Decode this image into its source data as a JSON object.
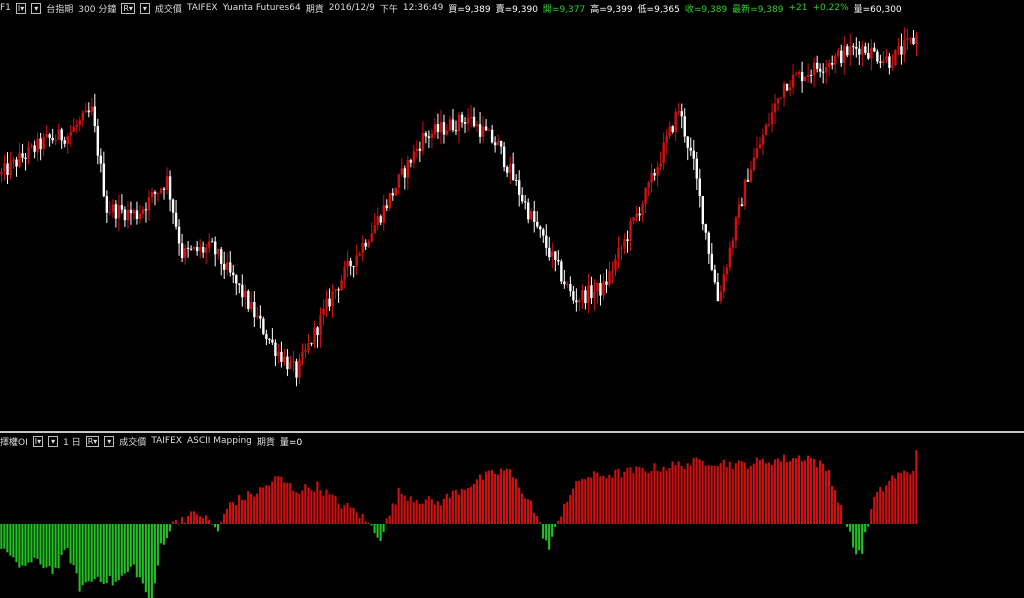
{
  "top_bar": {
    "symbol": "F1",
    "product": "台指期",
    "interval": "300 分鐘",
    "r_button": "R",
    "price_type": "成交價",
    "exchange": "TAIFEX",
    "source": "Yuanta Futures64",
    "market": "期貨",
    "date": "2016/12/9",
    "ampm": "下午",
    "time": "12:36:49",
    "bid": "買=9,389",
    "ask": "賣=9,390",
    "open": "開=9,377",
    "high": "高=9,399",
    "low": "低=9,365",
    "close": "收=9,389",
    "last": "最新=9,389",
    "change": "+21",
    "change_pct": "+0.22%",
    "volume": "量=60,300"
  },
  "sub_bar": {
    "indicator": "擇權OI",
    "interval": "1 日",
    "r_button": "R",
    "price_type": "成交價",
    "exchange": "TAIFEX",
    "source": "ASCII Mapping",
    "market": "期貨",
    "volume": "量=0"
  },
  "colors": {
    "up": "#d01010",
    "down": "#ffffff",
    "hist_pos": "#d01010",
    "hist_neg": "#22c022",
    "separator": "#c8c8c8",
    "background": "#000000"
  },
  "chart_data": [
    {
      "type": "candlestick",
      "ylim": [
        8000,
        9450
      ],
      "price_anchors": [
        [
          0,
          8900
        ],
        [
          7,
          8960
        ],
        [
          15,
          9020
        ],
        [
          22,
          9040
        ],
        [
          30,
          9120
        ],
        [
          35,
          8780
        ],
        [
          45,
          8760
        ],
        [
          55,
          8880
        ],
        [
          60,
          8620
        ],
        [
          70,
          8640
        ],
        [
          80,
          8480
        ],
        [
          90,
          8300
        ],
        [
          98,
          8200
        ],
        [
          110,
          8480
        ],
        [
          125,
          8740
        ],
        [
          140,
          9030
        ],
        [
          155,
          9100
        ],
        [
          165,
          9000
        ],
        [
          175,
          8770
        ],
        [
          190,
          8460
        ],
        [
          200,
          8500
        ],
        [
          215,
          8850
        ],
        [
          225,
          9130
        ],
        [
          230,
          8930
        ],
        [
          238,
          8460
        ],
        [
          248,
          8900
        ],
        [
          260,
          9220
        ],
        [
          285,
          9350
        ],
        [
          295,
          9300
        ],
        [
          305,
          9390
        ]
      ],
      "candle_count": 305,
      "last_close": 9389
    },
    {
      "type": "histogram",
      "ylim": [
        -35,
        35
      ],
      "value_anchors": [
        [
          0,
          -10
        ],
        [
          5,
          -20
        ],
        [
          12,
          -18
        ],
        [
          18,
          -22
        ],
        [
          22,
          -12
        ],
        [
          26,
          -30
        ],
        [
          32,
          -25
        ],
        [
          38,
          -28
        ],
        [
          44,
          -20
        ],
        [
          50,
          -38
        ],
        [
          53,
          -10
        ],
        [
          58,
          2
        ],
        [
          66,
          5
        ],
        [
          72,
          -3
        ],
        [
          76,
          10
        ],
        [
          85,
          15
        ],
        [
          92,
          22
        ],
        [
          98,
          16
        ],
        [
          105,
          18
        ],
        [
          112,
          10
        ],
        [
          118,
          6
        ],
        [
          126,
          -6
        ],
        [
          132,
          15
        ],
        [
          138,
          12
        ],
        [
          145,
          10
        ],
        [
          152,
          16
        ],
        [
          160,
          22
        ],
        [
          168,
          26
        ],
        [
          176,
          10
        ],
        [
          182,
          -12
        ],
        [
          187,
          10
        ],
        [
          193,
          22
        ],
        [
          205,
          24
        ],
        [
          215,
          26
        ],
        [
          225,
          28
        ],
        [
          235,
          30
        ],
        [
          245,
          28
        ],
        [
          255,
          30
        ],
        [
          268,
          32
        ],
        [
          275,
          25
        ],
        [
          281,
          -2
        ],
        [
          284,
          -14
        ],
        [
          286,
          -12
        ],
        [
          290,
          12
        ],
        [
          296,
          22
        ],
        [
          302,
          25
        ],
        [
          305,
          26
        ]
      ],
      "bar_count": 305
    }
  ]
}
